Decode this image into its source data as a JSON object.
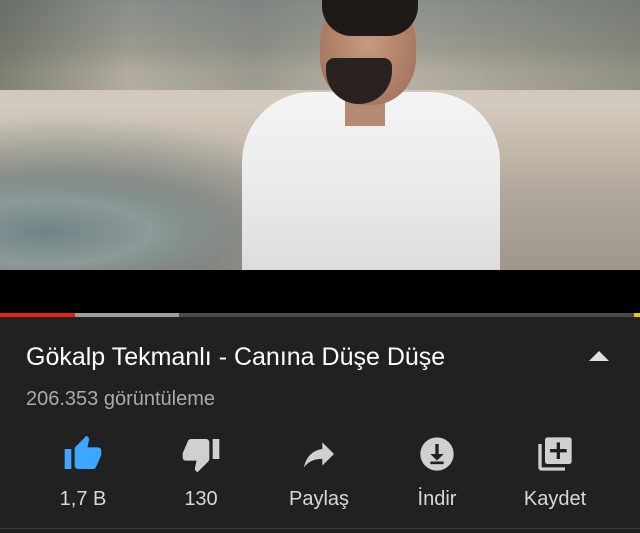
{
  "video": {
    "progress_played": 0.117,
    "progress_buffered": 0.28
  },
  "title": "Gökalp Tekmanlı - Canına Düşe Düşe",
  "views": "206.353 görüntüleme",
  "actions": {
    "like": "1,7 B",
    "dislike": "130",
    "share": "Paylaş",
    "download": "İndir",
    "save": "Kaydet"
  },
  "colors": {
    "background": "#212121",
    "progress": "#e62117",
    "like_active": "#3ea6ff",
    "icon": "#d0d0d0"
  },
  "icons": {
    "like": "thumbs-up-icon",
    "dislike": "thumbs-down-icon",
    "share": "share-arrow-icon",
    "download": "download-icon",
    "save": "add-to-playlist-icon",
    "expand": "chevron-up-icon"
  }
}
